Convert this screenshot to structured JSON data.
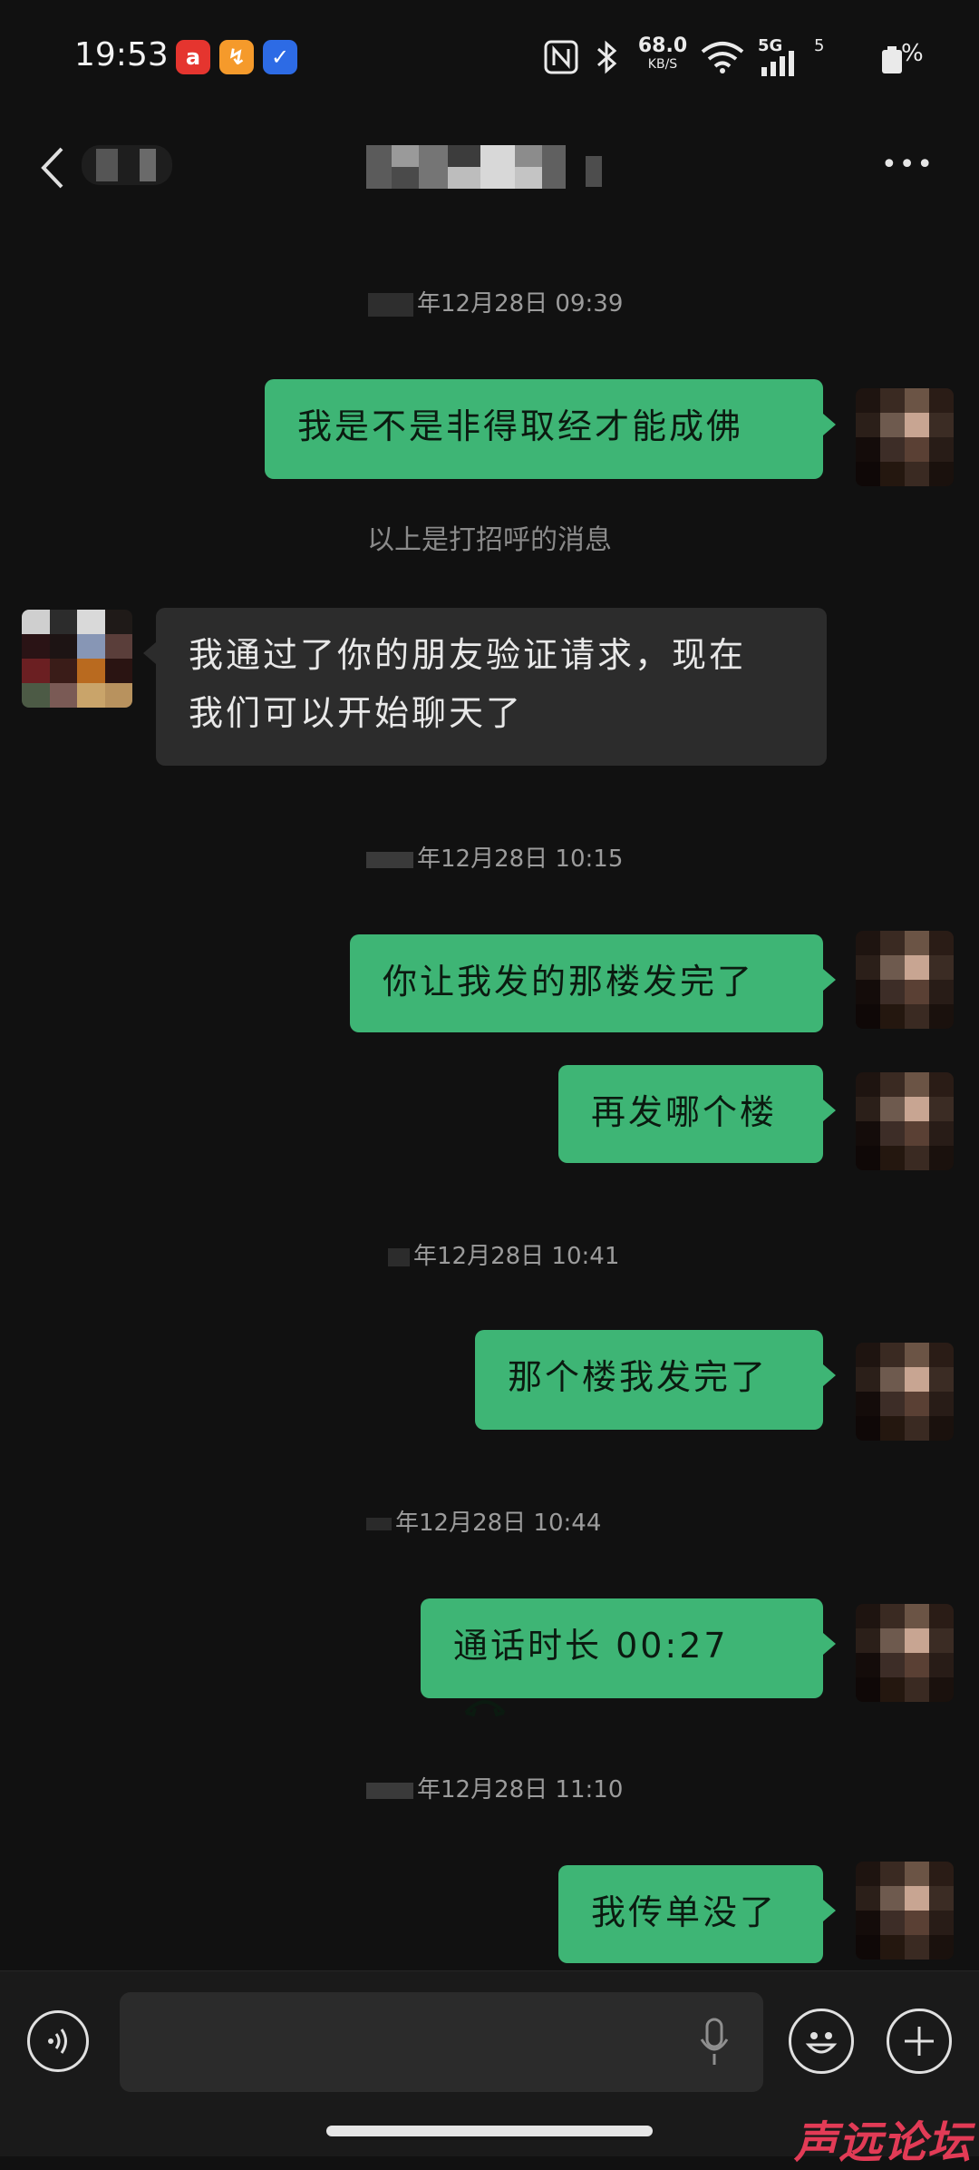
{
  "status_bar": {
    "time": "19:53",
    "net_speed_value": "68.0",
    "net_speed_unit": "KB/S",
    "signal_label": "5G",
    "signal_sub": "5",
    "battery_text": "%",
    "app_icons": [
      "a",
      "↯",
      "✓"
    ]
  },
  "header": {
    "more_label": "•••"
  },
  "timestamps": {
    "t1": "年12月28日 09:39",
    "t2": "年12月28日 10:15",
    "t3": "年12月28日 10:41",
    "t4": "年12月28日 10:44",
    "t5": "年12月28日 11:10"
  },
  "messages": {
    "m1": "我是不是非得取经才能成佛",
    "system_greeting": "以上是打招呼的消息",
    "m2_line1": "我通过了你的朋友验证请求，现在",
    "m2_line2": "我们可以开始聊天了",
    "m3": "你让我发的那楼发完了",
    "m4": "再发哪个楼",
    "m5": "那个楼我发完了",
    "m6": "通话时长 00:27",
    "m7": "我传单没了"
  },
  "input": {
    "value": "",
    "placeholder": ""
  },
  "watermark": "声远论坛",
  "colors": {
    "background": "#111111",
    "my_bubble": "#3eb575",
    "their_bubble": "#2c2c2c",
    "timestamp_text": "#9c9c9c",
    "watermark": "#e23b56"
  }
}
